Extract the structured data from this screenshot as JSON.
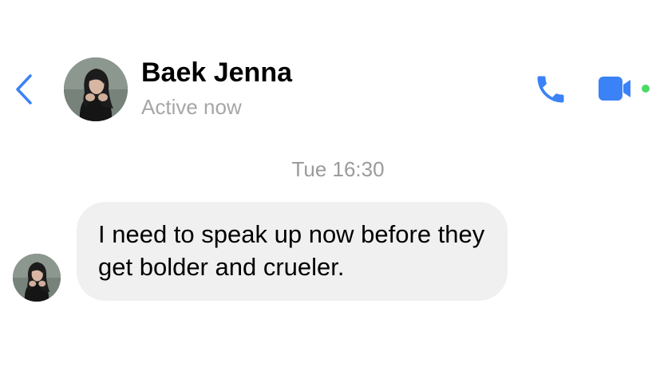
{
  "header": {
    "contact_name": "Baek Jenna",
    "status": "Active now",
    "back_icon": "chevron-left-icon",
    "call_icon": "phone-icon",
    "video_icon": "video-camera-icon"
  },
  "conversation": {
    "timestamp": "Tue 16:30",
    "messages": [
      {
        "sender": "Baek Jenna",
        "text": "I need to speak up now before they get bolder and crueler."
      }
    ]
  },
  "colors": {
    "accent": "#3b82f6",
    "active_dot": "#4cd964",
    "bubble_bg": "#f0f0f0",
    "muted_text": "#a6a6a6"
  }
}
